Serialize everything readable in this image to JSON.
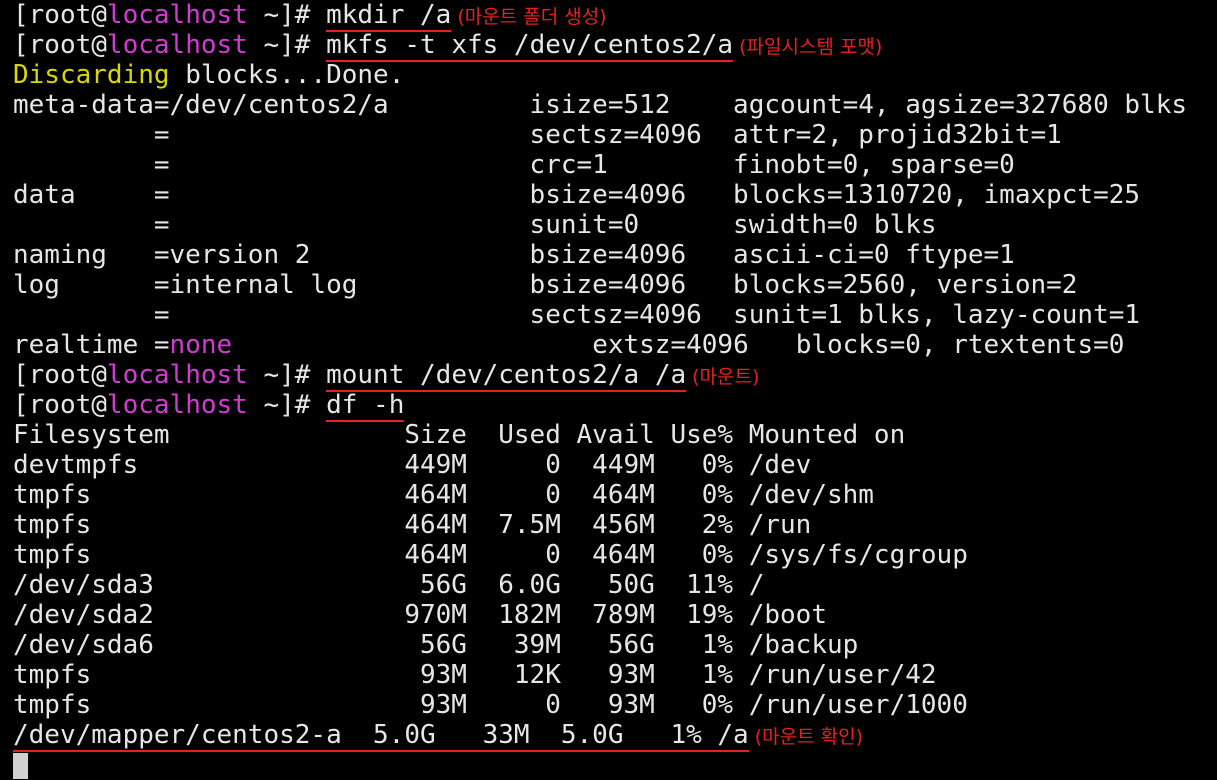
{
  "prompt": {
    "user": "[root@",
    "host": "localhost",
    "suffix": " ~]# "
  },
  "commands": [
    {
      "cmd": "mkdir /a",
      "note": "(마운트 폴더 생성)"
    },
    {
      "cmd": "mkfs -t xfs /dev/centos2/a",
      "note": "(파일시스템 포맷)"
    },
    {
      "cmd": "mount /dev/centos2/a /a",
      "note": "(마운트)"
    },
    {
      "cmd": "df -h",
      "note": ""
    }
  ],
  "mkfs_output": {
    "discarding_word": "Discarding",
    "discarding_rest": " blocks...Done.",
    "lines": [
      "meta-data=/dev/centos2/a         isize=512    agcount=4, agsize=327680 blks",
      "         =                       sectsz=4096  attr=2, projid32bit=1",
      "         =                       crc=1        finobt=0, sparse=0",
      "data     =                       bsize=4096   blocks=1310720, imaxpct=25",
      "         =                       sunit=0      swidth=0 blks",
      "naming   =version 2              bsize=4096   ascii-ci=0 ftype=1",
      "log      =internal log           bsize=4096   blocks=2560, version=2",
      "         =                       sectsz=4096  sunit=1 blks, lazy-count=1"
    ],
    "realtime_label": "realtime =",
    "realtime_value": "none",
    "realtime_rest": "                       extsz=4096   blocks=0, rtextents=0"
  },
  "df": {
    "header": "Filesystem               Size  Used Avail Use% Mounted on",
    "rows": [
      "devtmpfs                 449M     0  449M   0% /dev",
      "tmpfs                    464M     0  464M   0% /dev/shm",
      "tmpfs                    464M  7.5M  456M   2% /run",
      "tmpfs                    464M     0  464M   0% /sys/fs/cgroup",
      "/dev/sda3                 56G  6.0G   50G  11% /",
      "/dev/sda2                970M  182M  789M  19% /boot",
      "/dev/sda6                 56G   39M   56G   1% /backup",
      "tmpfs                     93M   12K   93M   1% /run/user/42",
      "tmpfs                     93M     0   93M   0% /run/user/1000"
    ],
    "last_row": "/dev/mapper/centos2-a  5.0G   33M  5.0G   1% /a",
    "last_note": "(마운트 확인)"
  },
  "colors": {
    "background": "#000000",
    "text": "#e6e6e6",
    "host": "#d23bd2",
    "highlight": "#d8d800",
    "annotation": "#e62020"
  }
}
